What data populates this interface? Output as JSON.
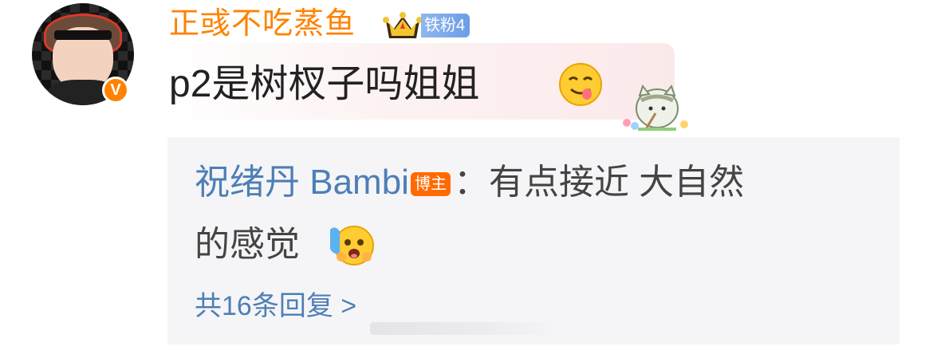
{
  "comment": {
    "author": "正彧不吃蒸鱼",
    "verified_badge": "V",
    "fan_badge": "铁粉4",
    "text": "p2是树杈子吗姐姐",
    "emoji": "yum-face-icon",
    "sticker": "cat-sticker-icon"
  },
  "reply": {
    "author": "祝绪丹 Bambi",
    "role_badge": "博主",
    "text_line1": "：有点接近 大自然",
    "text_line2": "的感觉",
    "emoji": "blush-hug-face-icon"
  },
  "more_replies": "共16条回复 >",
  "colors": {
    "username": "#ff8200",
    "link_blue": "#4e7fb5",
    "badge_orange": "#ff6a00",
    "reply_bg": "#f5f5f7"
  }
}
